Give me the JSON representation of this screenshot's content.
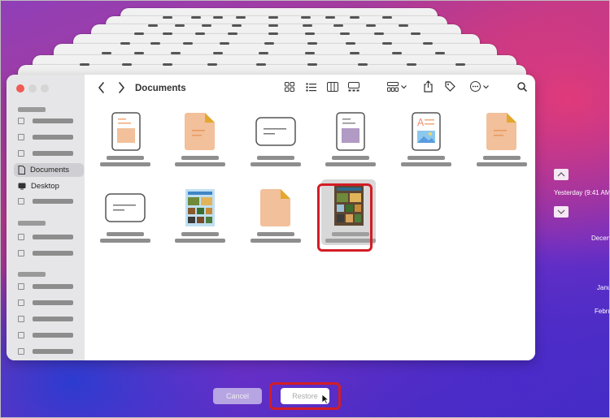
{
  "window": {
    "title": "Documents"
  },
  "sidebar": {
    "items": [
      {
        "label": "Documents",
        "icon": "document-icon",
        "selected": true
      },
      {
        "label": "Desktop",
        "icon": "desktop-icon",
        "selected": false
      }
    ]
  },
  "timeline": {
    "current_label": "Yesterday (9:41 AM)",
    "entries": [
      "Decen",
      "Janu",
      "Febru"
    ]
  },
  "buttons": {
    "cancel": "Cancel",
    "restore": "Restore"
  },
  "colors": {
    "highlight": "#d31d25",
    "accent_orange": "#f2c09a"
  }
}
